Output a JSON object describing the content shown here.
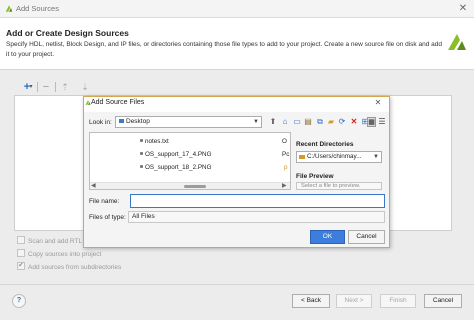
{
  "window": {
    "title": "Add Sources",
    "close_glyph": "✕"
  },
  "header": {
    "title": "Add or Create Design Sources",
    "description": "Specify HDL, netlist, Block Design, and IP files, or directories containing those file types to add to your project. Create a new source file on disk and add it to your project."
  },
  "toolbar": {
    "add_glyph": "+",
    "add_dropdown_glyph": "▾",
    "remove_glyph": "−",
    "up_glyph": "⇡",
    "down_glyph": "⇣"
  },
  "options": {
    "scan_rtl_label": "Scan and add RTL",
    "copy_sources_label": "Copy sources into project",
    "add_subdirs_label": "Add sources from subdirectories",
    "scan_rtl_checked": false,
    "copy_sources_checked": false,
    "add_subdirs_checked": true
  },
  "footer": {
    "help_label": "?",
    "back_label": "< Back",
    "next_label": "Next >",
    "finish_label": "Finish",
    "cancel_label": "Cancel"
  },
  "dialog": {
    "title": "Add Source Files",
    "close_glyph": "✕",
    "look_in_label": "Look in:",
    "look_in_value": "Desktop",
    "files": [
      {
        "name": "notes.txt"
      },
      {
        "name": "OS_support_17_4.PNG"
      },
      {
        "name": "OS_support_18_2.PNG"
      }
    ],
    "truncated_items": [
      "O",
      "Pc",
      "p"
    ],
    "recent_directories_label": "Recent Directories",
    "recent_directory_value": "C:/Users/chinmay...",
    "file_preview_label": "File Preview",
    "file_preview_placeholder": "Select a file to preview.",
    "file_name_label": "File name:",
    "file_name_value": "",
    "file_type_label": "Files of type:",
    "file_type_value": "All Files",
    "ok_label": "OK",
    "cancel_label": "Cancel"
  },
  "colors": {
    "accent_blue": "#3d7ddb",
    "dialog_border": "#d4a64f",
    "xilinx_green": "#8bbd2b"
  }
}
